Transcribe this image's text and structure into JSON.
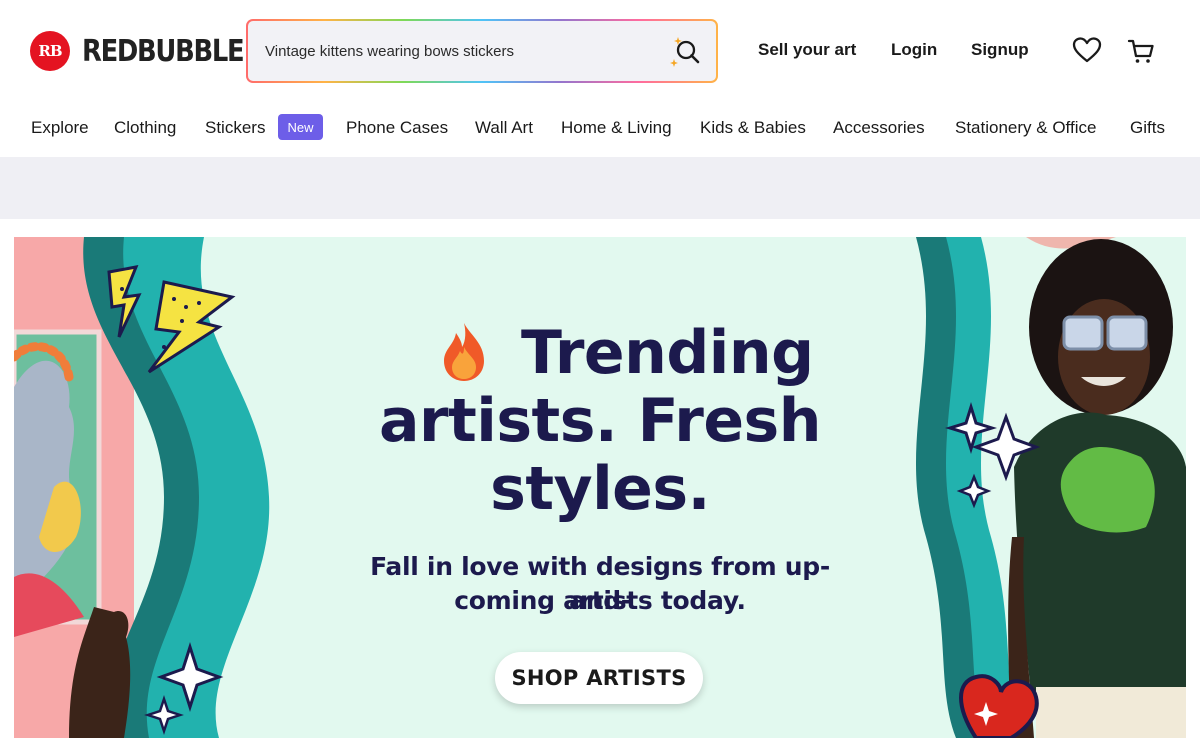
{
  "header": {
    "logo_badge": "RB",
    "logo_text": "REDBUBBLE",
    "search_value": "Vintage kittens wearing bows stickers",
    "links": {
      "sell": "Sell your art",
      "login": "Login",
      "signup": "Signup"
    },
    "icons": [
      "search-icon",
      "heart-icon",
      "cart-icon"
    ]
  },
  "nav": {
    "items": [
      "Explore",
      "Clothing",
      "Stickers",
      "Phone Cases",
      "Wall Art",
      "Home & Living",
      "Kids & Babies",
      "Accessories",
      "Stationery & Office",
      "Gifts"
    ],
    "new_badge": "New"
  },
  "hero": {
    "title_line1": "Trending",
    "title_line2": "artists. Fresh",
    "title_line3": "styles.",
    "subtitle_line1": "Fall in love with designs from up-and-",
    "subtitle_line2": "coming artists today.",
    "cta": "SHOP ARTISTS"
  },
  "colors": {
    "brand_red": "#e41321",
    "badge_purple": "#6d5ee8",
    "hero_bg": "#e2f9ef",
    "hero_text": "#1c1a4d",
    "teal": "#22b2ae"
  }
}
